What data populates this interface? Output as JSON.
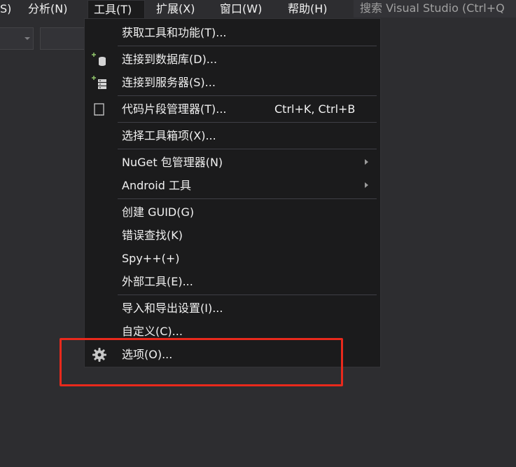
{
  "menubar": {
    "items": [
      {
        "label": "S)"
      },
      {
        "label": "分析(N)"
      },
      {
        "label": "工具(T)"
      },
      {
        "label": "扩展(X)"
      },
      {
        "label": "窗口(W)"
      },
      {
        "label": "帮助(H)"
      }
    ],
    "search_text": "搜索 Visual Studio (Ctrl+Q"
  },
  "tools_menu": {
    "items": [
      {
        "label": "获取工具和功能(T)..."
      },
      {
        "label": "连接到数据库(D)...",
        "icon": "database-plus-icon"
      },
      {
        "label": "连接到服务器(S)...",
        "icon": "server-plus-icon"
      },
      {
        "label": "代码片段管理器(T)...",
        "shortcut": "Ctrl+K, Ctrl+B",
        "icon": "snippet-icon"
      },
      {
        "label": "选择工具箱项(X)..."
      },
      {
        "label": "NuGet 包管理器(N)",
        "has_submenu": true
      },
      {
        "label": "Android 工具",
        "has_submenu": true
      },
      {
        "label": "创建 GUID(G)"
      },
      {
        "label": "错误查找(K)"
      },
      {
        "label": "Spy++(+)"
      },
      {
        "label": "外部工具(E)..."
      },
      {
        "label": "导入和导出设置(I)..."
      },
      {
        "label": "自定义(C)..."
      },
      {
        "label": "选项(O)...",
        "icon": "gear-icon"
      }
    ]
  },
  "colors": {
    "background": "#2d2d30",
    "menu_background": "#1b1b1c",
    "text": "#f1f1f1",
    "highlight_annotation": "#e8291c"
  }
}
